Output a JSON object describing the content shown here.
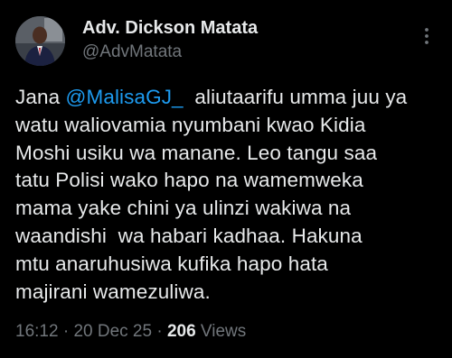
{
  "author": {
    "display_name": "Adv. Dickson Matata",
    "handle": "@AdvMatata"
  },
  "more_icon": "more-horizontal-icon",
  "tweet": {
    "line1_pre": "Jana ",
    "mention": "@MalisaGJ_",
    "line1_post": "  aliutaarifu umma juu ya",
    "lines": [
      "watu waliovamia nyumbani kwao Kidia",
      "Moshi usiku wa manane. Leo tangu saa",
      "tatu Polisi wako hapo na wamemweka",
      "mama yake chini ya ulinzi wakiwa na",
      "waandishi  wa habari kadhaa. Hakuna",
      "mtu anaruhusiwa kufika hapo hata",
      "majirani wamezuliwa."
    ]
  },
  "meta": {
    "time": "16:12",
    "separator": " · ",
    "date": "20 Dec 25",
    "views_count": "206",
    "views_label": " Views"
  },
  "colors": {
    "background": "#000000",
    "text": "#e7e9ea",
    "secondary": "#71767b",
    "mention": "#1d9bf0"
  }
}
